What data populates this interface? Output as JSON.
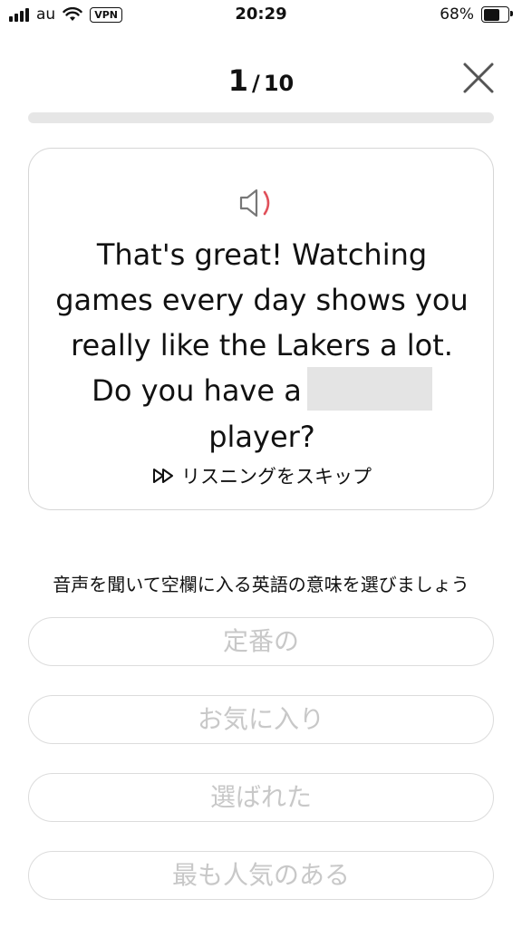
{
  "status_bar": {
    "carrier": "au",
    "vpn": "VPN",
    "time": "20:29",
    "battery_percent": "68%",
    "battery_level": 0.68
  },
  "header": {
    "current": "1",
    "separator": "/",
    "total": "10",
    "progress": 0.0
  },
  "question": {
    "sentence_line1": "That's great! Watching games every day shows you really like the Lakers a lot. Do you have a",
    "sentence_line2": "player?",
    "skip_label": "リスニングをスキップ"
  },
  "instruction": "音声を聞いて空欄に入る英語の意味を選びましょう",
  "options": [
    {
      "label": "定番の"
    },
    {
      "label": "お気に入り"
    },
    {
      "label": "選ばれた"
    },
    {
      "label": "最も人気のある"
    }
  ],
  "colors": {
    "speaker_wave": "#e0505a",
    "option_text": "#c8c8c8",
    "blank": "#e4e4e4"
  }
}
